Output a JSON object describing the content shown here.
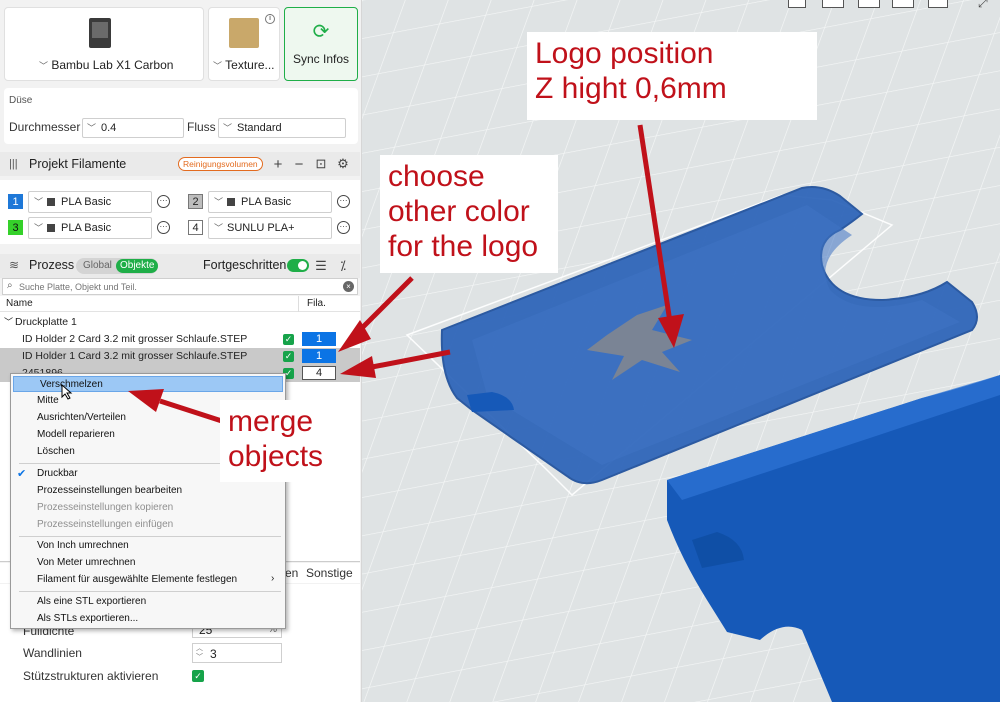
{
  "printer": {
    "name": "Bambu Lab X1 Carbon",
    "plate": "Texture...",
    "sync_label": "Sync Infos"
  },
  "nozzle": {
    "section": "Düse",
    "diameter_label": "Durchmesser",
    "diameter_value": "0.4",
    "flow_label": "Fluss",
    "flow_value": "Standard"
  },
  "filaments": {
    "title": "Projekt Filamente",
    "purge_label": "Reinigungsvolumen",
    "items": [
      {
        "num": "1",
        "name": "PLA Basic",
        "color": "#1e78d8"
      },
      {
        "num": "2",
        "name": "PLA Basic",
        "color": "#bdbdbd"
      },
      {
        "num": "3",
        "name": "PLA Basic",
        "color": "#35d12a"
      },
      {
        "num": "4",
        "name": "SUNLU PLA+",
        "color": "#ffffff"
      }
    ]
  },
  "process": {
    "title": "Prozess",
    "global": "Global",
    "objects": "Objekte",
    "advanced": "Fortgeschritten"
  },
  "search": {
    "placeholder": "Suche Platte, Objekt und Teil."
  },
  "tree": {
    "col_name": "Name",
    "col_fila": "Fila.",
    "plate": "Druckplatte 1",
    "rows": [
      {
        "name": "ID Holder 2 Card 3.2 mit grosser Schlaufe.STEP",
        "fila": "1"
      },
      {
        "name": "ID Holder 1 Card 3.2 mit grosser Schlaufe.STEP",
        "fila": "1"
      },
      {
        "name": "2451896",
        "fila": "4"
      }
    ]
  },
  "tabs_partial": {
    "en": "en",
    "sonstige": "Sonstige"
  },
  "settings": {
    "infill_label": "Fülldichte",
    "infill_value": "25",
    "infill_unit": "%",
    "walls_label": "Wandlinien",
    "walls_value": "3",
    "supports_label": "Stützstrukturen aktivieren"
  },
  "context_menu": {
    "items": [
      {
        "label": "Verschmelzen",
        "state": "highlighted"
      },
      {
        "label": "Mitte"
      },
      {
        "label": "Ausrichten/Verteilen"
      },
      {
        "label": "Modell reparieren"
      },
      {
        "label": "Löschen"
      },
      {
        "label": "Druckbar",
        "checked": true
      },
      {
        "label": "Prozesseinstellungen bearbeiten"
      },
      {
        "label": "Prozesseinstellungen kopieren",
        "disabled": true
      },
      {
        "label": "Prozesseinstellungen einfügen",
        "disabled": true
      },
      {
        "label": "Von Inch umrechnen"
      },
      {
        "label": "Von Meter umrechnen"
      },
      {
        "label": "Filament für ausgewählte Elemente festlegen",
        "submenu": true
      },
      {
        "label": "Als eine STL exportieren"
      },
      {
        "label": "Als STLs exportieren..."
      }
    ]
  },
  "annotations": {
    "logo_line1": "Logo position",
    "logo_line2": "Z hight 0,6mm",
    "color_line1": "choose",
    "color_line2": "other color",
    "color_line3": "for the logo",
    "merge_line1": "merge",
    "merge_line2": "objects"
  },
  "colors": {
    "accent": "#16a34a",
    "annotation": "#c0111a",
    "model": "#1659b8",
    "selected": "#0b74e5"
  }
}
